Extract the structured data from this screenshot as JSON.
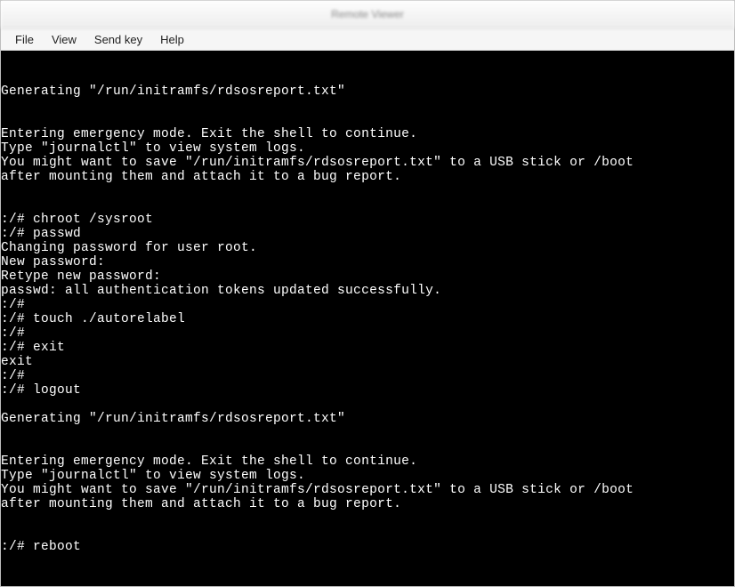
{
  "title": "Remote Viewer",
  "menu": {
    "file": "File",
    "view": "View",
    "sendkey": "Send key",
    "help": "Help"
  },
  "terminal": {
    "lines": [
      "",
      "Generating \"/run/initramfs/rdsosreport.txt\"",
      "",
      "",
      "Entering emergency mode. Exit the shell to continue.",
      "Type \"journalctl\" to view system logs.",
      "You might want to save \"/run/initramfs/rdsosreport.txt\" to a USB stick or /boot",
      "after mounting them and attach it to a bug report.",
      "",
      "",
      ":/# chroot /sysroot",
      ":/# passwd",
      "Changing password for user root.",
      "New password:",
      "Retype new password:",
      "passwd: all authentication tokens updated successfully.",
      ":/#",
      ":/# touch ./autorelabel",
      ":/#",
      ":/# exit",
      "exit",
      ":/#",
      ":/# logout",
      "",
      "Generating \"/run/initramfs/rdsosreport.txt\"",
      "",
      "",
      "Entering emergency mode. Exit the shell to continue.",
      "Type \"journalctl\" to view system logs.",
      "You might want to save \"/run/initramfs/rdsosreport.txt\" to a USB stick or /boot",
      "after mounting them and attach it to a bug report.",
      "",
      "",
      ":/# reboot"
    ]
  }
}
